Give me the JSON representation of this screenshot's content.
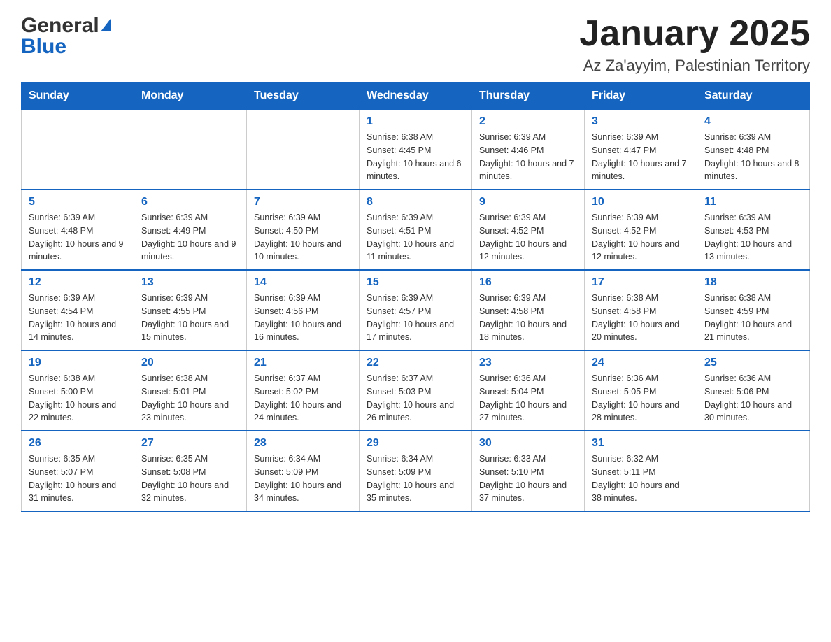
{
  "header": {
    "logo_general": "General",
    "logo_blue": "Blue",
    "month_title": "January 2025",
    "location": "Az Za'ayyim, Palestinian Territory"
  },
  "days_of_week": [
    "Sunday",
    "Monday",
    "Tuesday",
    "Wednesday",
    "Thursday",
    "Friday",
    "Saturday"
  ],
  "weeks": [
    [
      {
        "day": "",
        "info": ""
      },
      {
        "day": "",
        "info": ""
      },
      {
        "day": "",
        "info": ""
      },
      {
        "day": "1",
        "info": "Sunrise: 6:38 AM\nSunset: 4:45 PM\nDaylight: 10 hours and 6 minutes."
      },
      {
        "day": "2",
        "info": "Sunrise: 6:39 AM\nSunset: 4:46 PM\nDaylight: 10 hours and 7 minutes."
      },
      {
        "day": "3",
        "info": "Sunrise: 6:39 AM\nSunset: 4:47 PM\nDaylight: 10 hours and 7 minutes."
      },
      {
        "day": "4",
        "info": "Sunrise: 6:39 AM\nSunset: 4:48 PM\nDaylight: 10 hours and 8 minutes."
      }
    ],
    [
      {
        "day": "5",
        "info": "Sunrise: 6:39 AM\nSunset: 4:48 PM\nDaylight: 10 hours and 9 minutes."
      },
      {
        "day": "6",
        "info": "Sunrise: 6:39 AM\nSunset: 4:49 PM\nDaylight: 10 hours and 9 minutes."
      },
      {
        "day": "7",
        "info": "Sunrise: 6:39 AM\nSunset: 4:50 PM\nDaylight: 10 hours and 10 minutes."
      },
      {
        "day": "8",
        "info": "Sunrise: 6:39 AM\nSunset: 4:51 PM\nDaylight: 10 hours and 11 minutes."
      },
      {
        "day": "9",
        "info": "Sunrise: 6:39 AM\nSunset: 4:52 PM\nDaylight: 10 hours and 12 minutes."
      },
      {
        "day": "10",
        "info": "Sunrise: 6:39 AM\nSunset: 4:52 PM\nDaylight: 10 hours and 12 minutes."
      },
      {
        "day": "11",
        "info": "Sunrise: 6:39 AM\nSunset: 4:53 PM\nDaylight: 10 hours and 13 minutes."
      }
    ],
    [
      {
        "day": "12",
        "info": "Sunrise: 6:39 AM\nSunset: 4:54 PM\nDaylight: 10 hours and 14 minutes."
      },
      {
        "day": "13",
        "info": "Sunrise: 6:39 AM\nSunset: 4:55 PM\nDaylight: 10 hours and 15 minutes."
      },
      {
        "day": "14",
        "info": "Sunrise: 6:39 AM\nSunset: 4:56 PM\nDaylight: 10 hours and 16 minutes."
      },
      {
        "day": "15",
        "info": "Sunrise: 6:39 AM\nSunset: 4:57 PM\nDaylight: 10 hours and 17 minutes."
      },
      {
        "day": "16",
        "info": "Sunrise: 6:39 AM\nSunset: 4:58 PM\nDaylight: 10 hours and 18 minutes."
      },
      {
        "day": "17",
        "info": "Sunrise: 6:38 AM\nSunset: 4:58 PM\nDaylight: 10 hours and 20 minutes."
      },
      {
        "day": "18",
        "info": "Sunrise: 6:38 AM\nSunset: 4:59 PM\nDaylight: 10 hours and 21 minutes."
      }
    ],
    [
      {
        "day": "19",
        "info": "Sunrise: 6:38 AM\nSunset: 5:00 PM\nDaylight: 10 hours and 22 minutes."
      },
      {
        "day": "20",
        "info": "Sunrise: 6:38 AM\nSunset: 5:01 PM\nDaylight: 10 hours and 23 minutes."
      },
      {
        "day": "21",
        "info": "Sunrise: 6:37 AM\nSunset: 5:02 PM\nDaylight: 10 hours and 24 minutes."
      },
      {
        "day": "22",
        "info": "Sunrise: 6:37 AM\nSunset: 5:03 PM\nDaylight: 10 hours and 26 minutes."
      },
      {
        "day": "23",
        "info": "Sunrise: 6:36 AM\nSunset: 5:04 PM\nDaylight: 10 hours and 27 minutes."
      },
      {
        "day": "24",
        "info": "Sunrise: 6:36 AM\nSunset: 5:05 PM\nDaylight: 10 hours and 28 minutes."
      },
      {
        "day": "25",
        "info": "Sunrise: 6:36 AM\nSunset: 5:06 PM\nDaylight: 10 hours and 30 minutes."
      }
    ],
    [
      {
        "day": "26",
        "info": "Sunrise: 6:35 AM\nSunset: 5:07 PM\nDaylight: 10 hours and 31 minutes."
      },
      {
        "day": "27",
        "info": "Sunrise: 6:35 AM\nSunset: 5:08 PM\nDaylight: 10 hours and 32 minutes."
      },
      {
        "day": "28",
        "info": "Sunrise: 6:34 AM\nSunset: 5:09 PM\nDaylight: 10 hours and 34 minutes."
      },
      {
        "day": "29",
        "info": "Sunrise: 6:34 AM\nSunset: 5:09 PM\nDaylight: 10 hours and 35 minutes."
      },
      {
        "day": "30",
        "info": "Sunrise: 6:33 AM\nSunset: 5:10 PM\nDaylight: 10 hours and 37 minutes."
      },
      {
        "day": "31",
        "info": "Sunrise: 6:32 AM\nSunset: 5:11 PM\nDaylight: 10 hours and 38 minutes."
      },
      {
        "day": "",
        "info": ""
      }
    ]
  ]
}
